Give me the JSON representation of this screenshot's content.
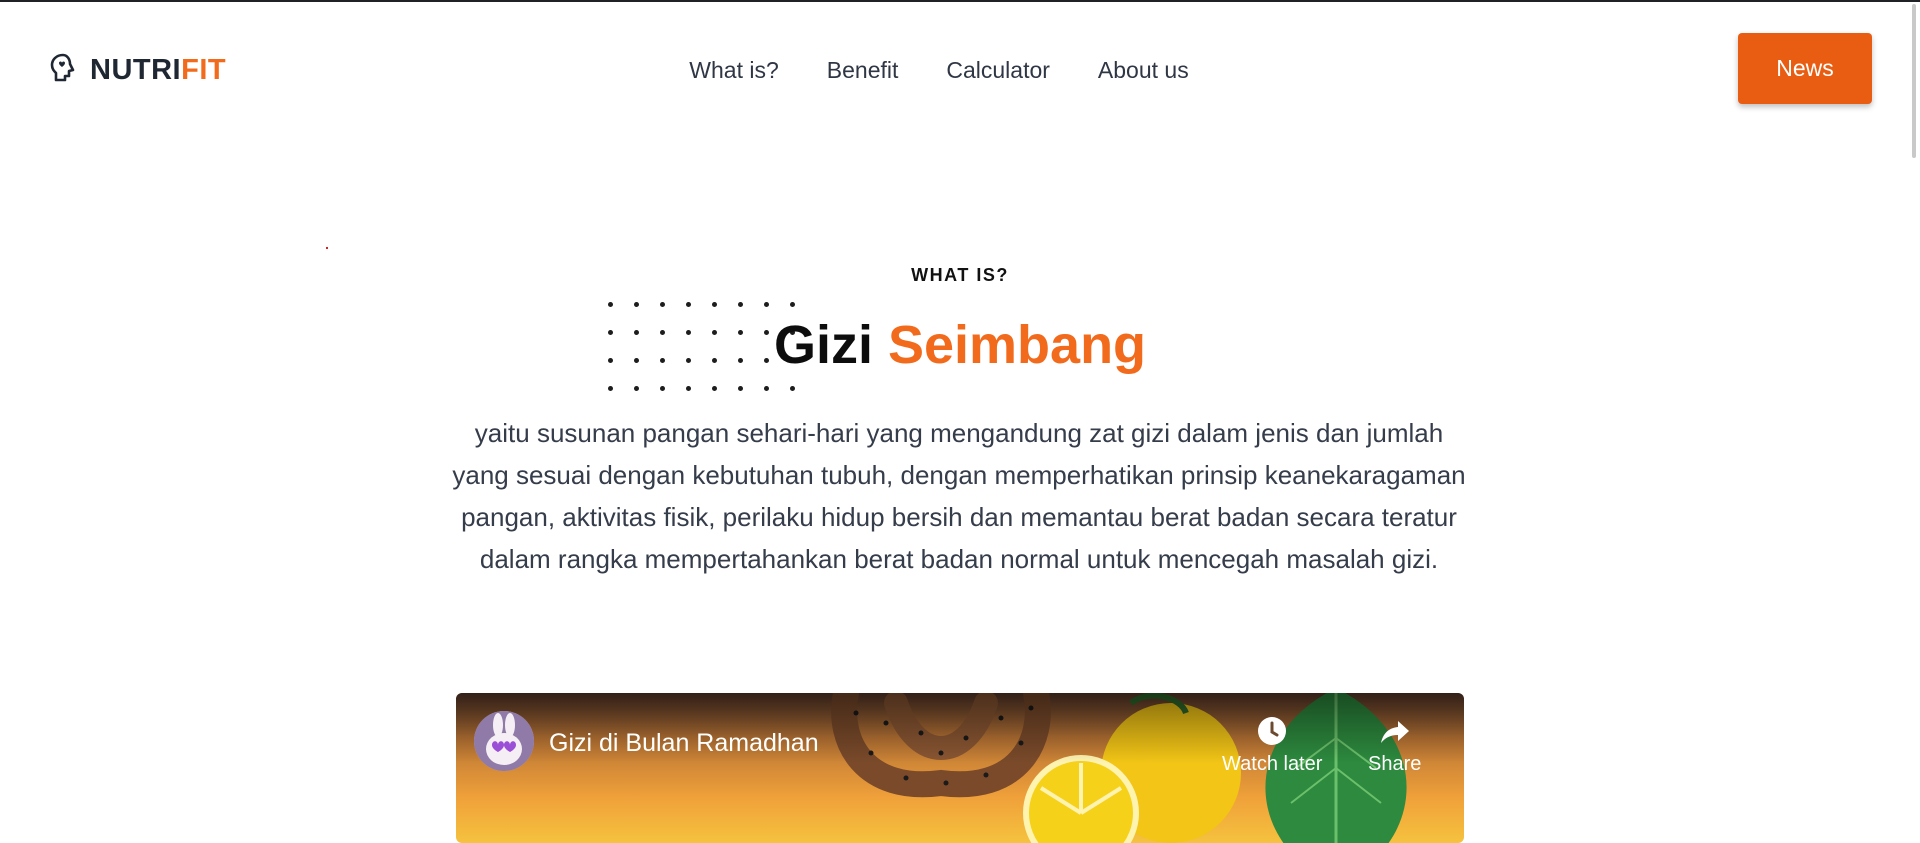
{
  "brand": {
    "name_part1": "NUTRI",
    "name_part2": "FIT",
    "icon": "brain-head-icon",
    "accent": "#f26b1d"
  },
  "nav": {
    "items": [
      {
        "label": "What is?"
      },
      {
        "label": "Benefit"
      },
      {
        "label": "Calculator"
      },
      {
        "label": "About us"
      }
    ]
  },
  "cta": {
    "label": "News",
    "color": "#e95d12"
  },
  "section": {
    "eyebrow": "WHAT IS?",
    "title_part1": "Gizi",
    "title_part2": "Seimbang",
    "description": "yaitu susunan pangan sehari-hari yang mengandung zat gizi dalam jenis dan jumlah yang sesuai dengan kebutuhan tubuh, dengan memperhatikan prinsip keanekaragaman pangan, aktivitas fisik, perilaku hidup bersih dan memantau berat badan secara teratur dalam rangka mempertahankan berat badan normal untuk mencegah masalah gizi."
  },
  "video": {
    "title": "Gizi di Bulan Ramadhan",
    "watch_later": "Watch later",
    "share": "Share",
    "channel_icon": "bunny-avatar-icon"
  }
}
